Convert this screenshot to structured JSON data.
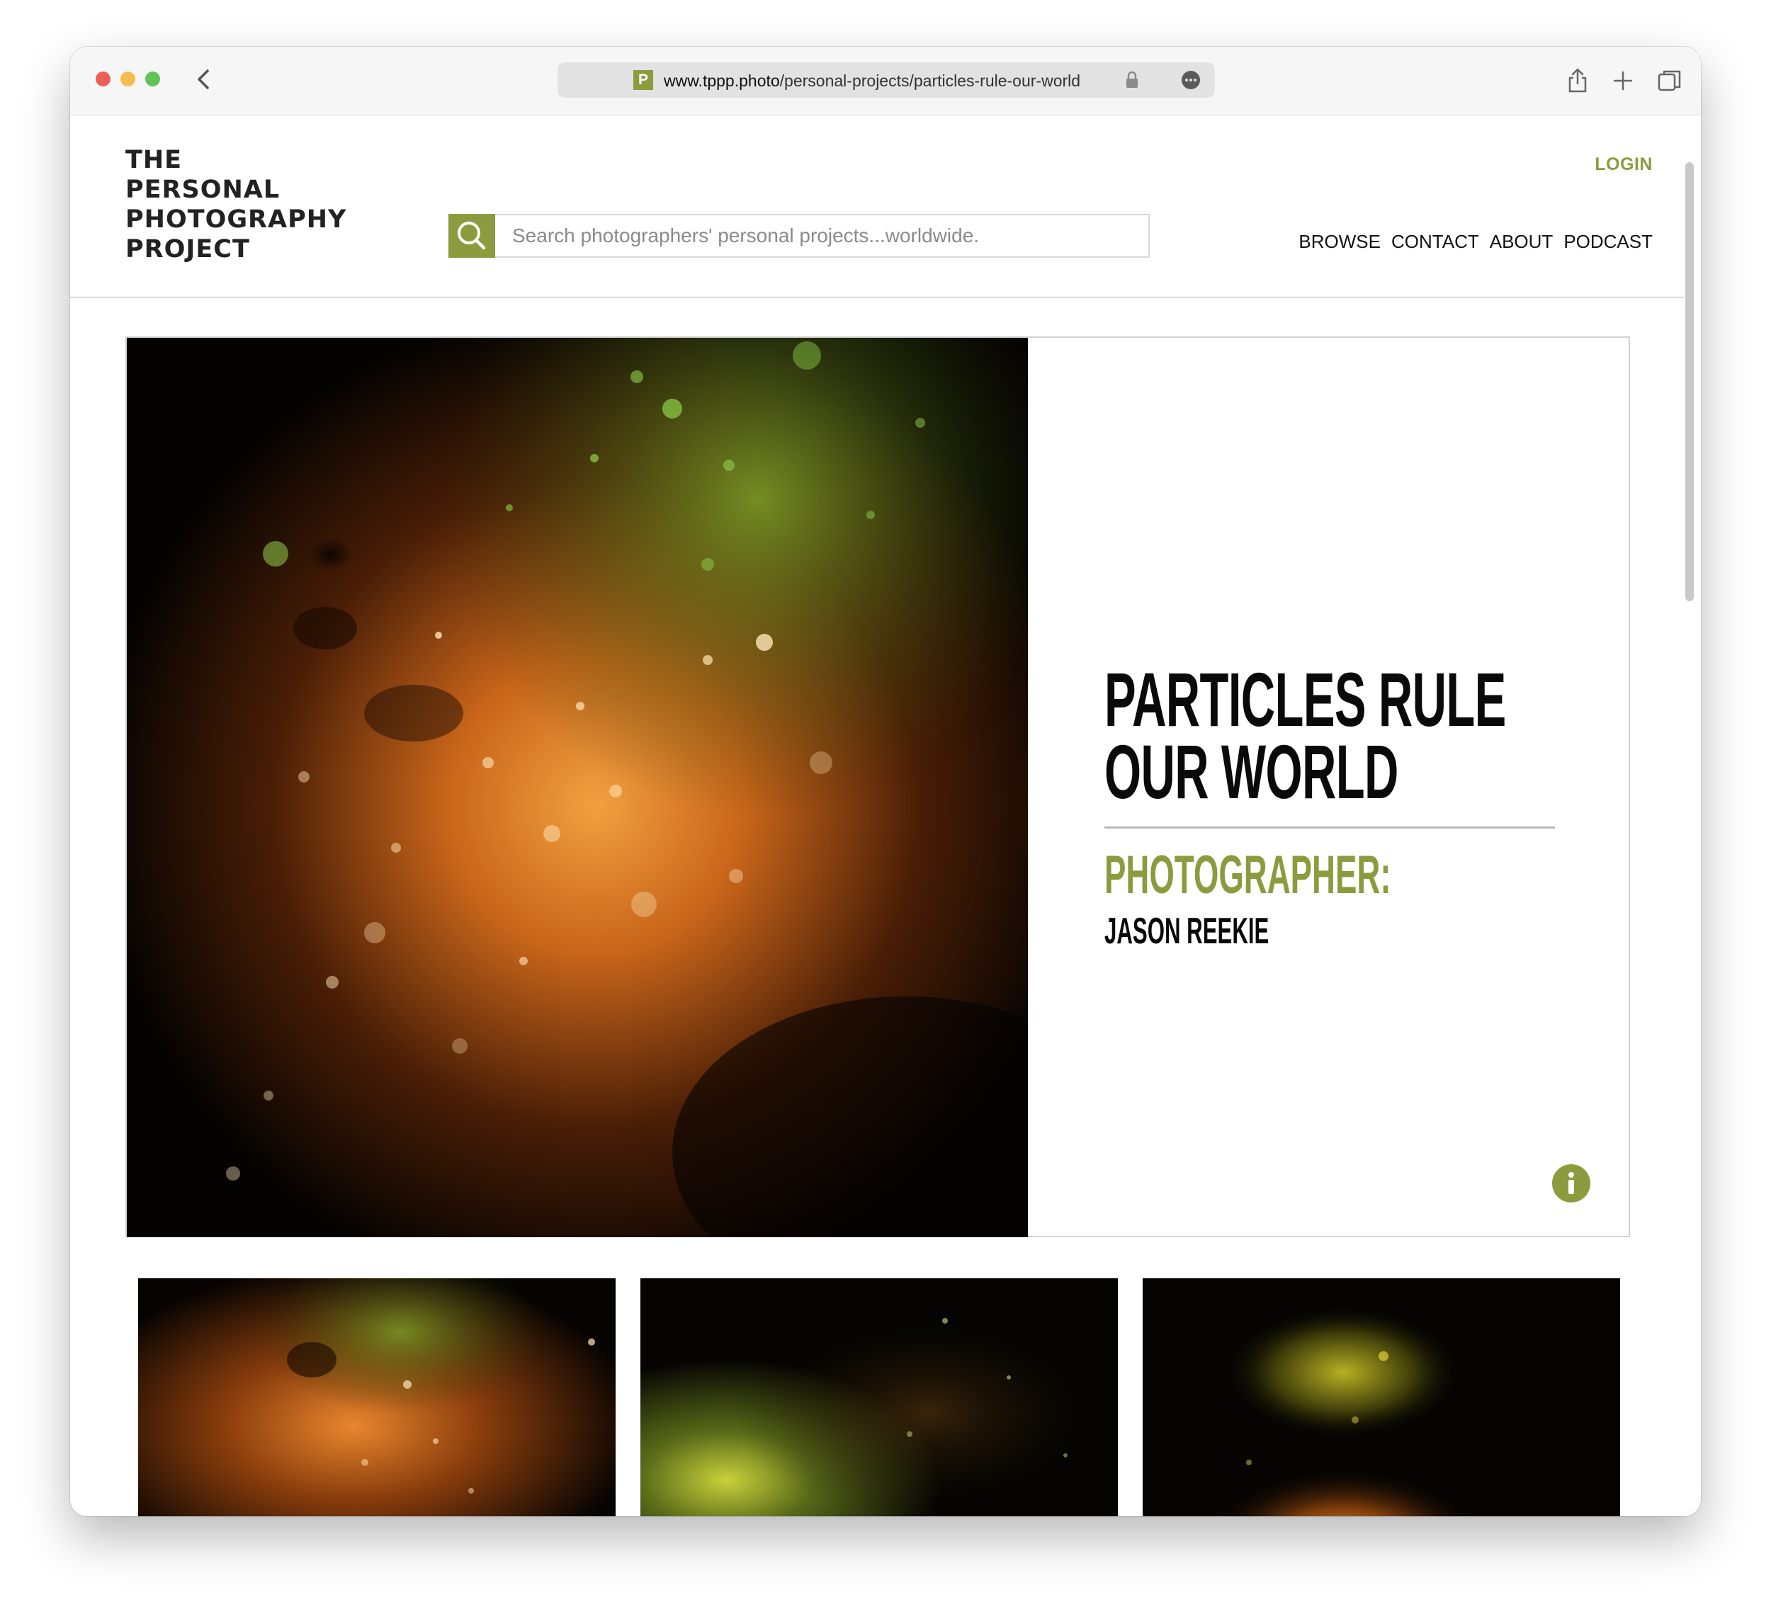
{
  "browser": {
    "url_host": "www.tppp.photo",
    "url_path": "/personal-projects/particles-rule-our-world",
    "favicon_letter": "P"
  },
  "site": {
    "logo_lines": [
      "THE",
      "PERSONAL",
      "PHOTOGRAPHY",
      "PROJECT"
    ],
    "search_placeholder": "Search photographers' personal projects...worldwide.",
    "login": "LOGIN",
    "nav": [
      "BROWSE",
      "CONTACT",
      "ABOUT",
      "PODCAST"
    ]
  },
  "project": {
    "title_lines": [
      "PARTICLES RULE",
      "OUR WORLD"
    ],
    "photographer_label": "PHOTOGRAPHER:",
    "photographer_name": "JASON REEKIE"
  },
  "colors": {
    "accent": "#8b9b3e",
    "text": "#0a0a0a"
  },
  "icons": [
    "back-chevron-icon",
    "lock-icon",
    "more-icon",
    "share-icon",
    "new-tab-icon",
    "tabs-icon",
    "search-icon",
    "info-icon"
  ]
}
